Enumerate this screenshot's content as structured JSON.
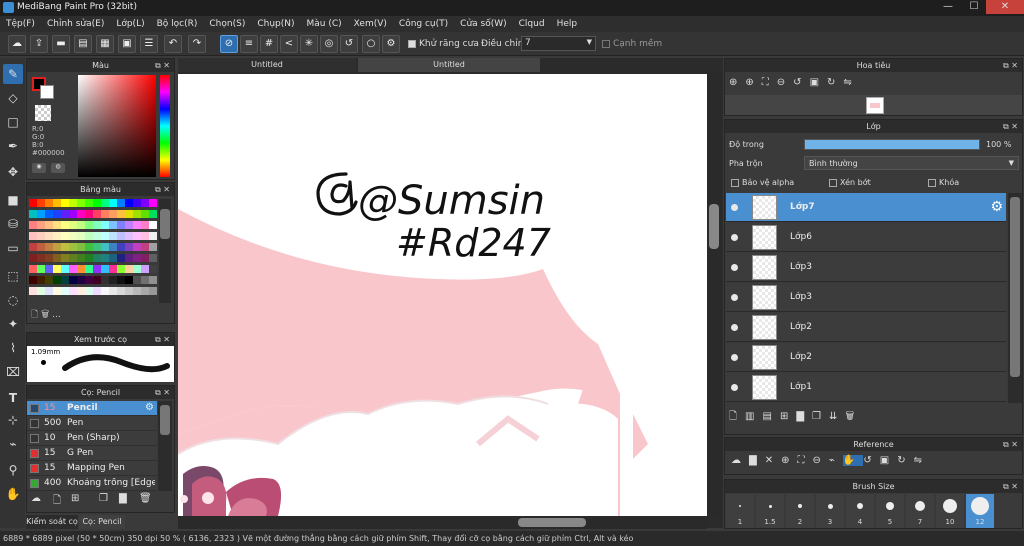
{
  "app": {
    "title": "MediBang Paint Pro (32bit)",
    "min": "—",
    "max": "☐",
    "close": "✕"
  },
  "menu": [
    "Tệp(F)",
    "Chỉnh sửa(E)",
    "Lớp(L)",
    "Bộ lọc(R)",
    "Chọn(S)",
    "Chụp(N)",
    "Màu (C)",
    "Xem(V)",
    "Công cụ(T)",
    "Cửa số(W)",
    "Clqud",
    "Help"
  ],
  "toolbar": {
    "antialias": "Khử răng cưa",
    "adjust_label": "Điều chỉnh",
    "adjust_value": "7",
    "soft_edge": "Cạnh mềm"
  },
  "tabs": [
    "Untitled",
    "Untitled"
  ],
  "color_panel": {
    "title": "Màu",
    "r": "R:0",
    "g": "G:0",
    "b": "B:0",
    "hex": "#000000"
  },
  "palette_panel": {
    "title": "Bảng màu",
    "more": "..."
  },
  "brush_preview": {
    "title": "Xem trước cọ",
    "size": "1.09mm"
  },
  "brush_panel": {
    "title": "Cọ: Pencil",
    "items": [
      {
        "size": "15",
        "name": "Pencil",
        "color": "#2a4a70"
      },
      {
        "size": "500",
        "name": "Pen",
        "color": "#333333"
      },
      {
        "size": "10",
        "name": "Pen (Sharp)",
        "color": "#333333"
      },
      {
        "size": "15",
        "name": "G Pen",
        "color": "#e03030"
      },
      {
        "size": "15",
        "name": "Mapping Pen",
        "color": "#e03030"
      },
      {
        "size": "400",
        "name": "Khoảng trống [Edge I",
        "color": "#3a3"
      }
    ]
  },
  "bottom_tabs": [
    "Kiểm soát cọ",
    "Cọ: Pencil"
  ],
  "nav_panel": {
    "title": "Hoa tiêu"
  },
  "layer_panel": {
    "title": "Lớp",
    "opacity_label": "Độ trong",
    "opacity_value": "100 %",
    "opacity": 1.0,
    "blend_label": "Pha trộn",
    "blend_value": "Bình thường",
    "protect_alpha": "Bảo vệ alpha",
    "clip": "Xén bớt",
    "lock": "Khóa",
    "layers": [
      "Lớp7",
      "Lớp6",
      "Lớp3",
      "Lớp3",
      "Lớp2",
      "Lớp2",
      "Lớp1"
    ]
  },
  "reference_panel": {
    "title": "Reference"
  },
  "brush_size_panel": {
    "title": "Brush Size",
    "sizes": [
      "1",
      "1.5",
      "2",
      "3",
      "4",
      "5",
      "7",
      "10",
      "12"
    ]
  },
  "canvas_text": {
    "line1": "@Sumsin",
    "line2": "#Rd247"
  },
  "status": "6889 * 6889 pixel  (50 * 50cm)  350 dpi  50 %  ( 6136, 2323 )  Vẽ một đường thẳng bằng cách giữ phím Shift, Thay đổi cỡ cọ bằng cách giữ phím Ctrl, Alt và kéo",
  "colors": {
    "accent": "#4a90d0",
    "canvas_pink": "#f9c6cc",
    "mauve": "#a86f8e"
  }
}
